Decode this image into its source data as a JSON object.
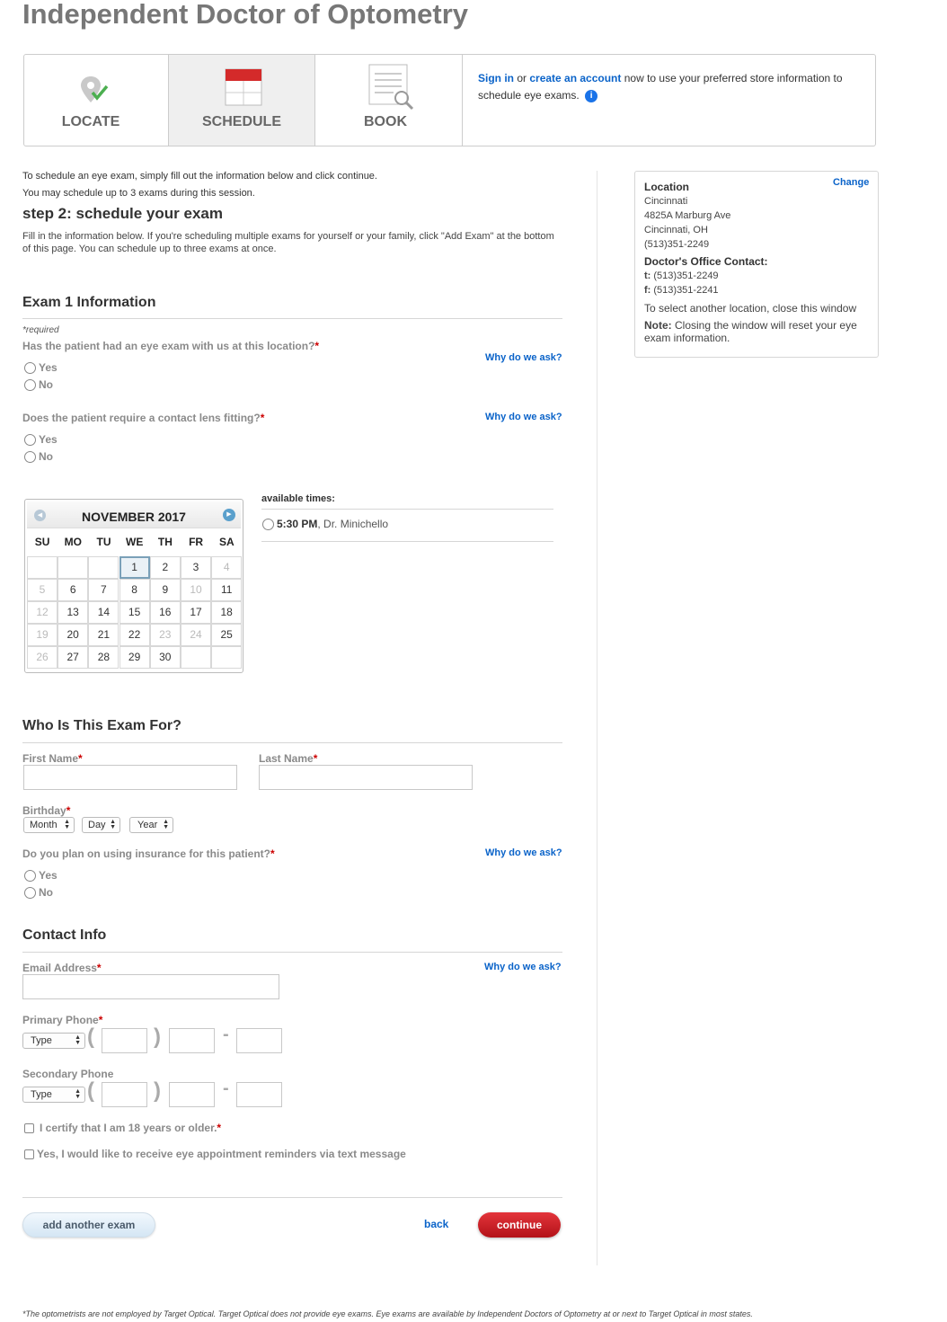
{
  "page_title": "Independent Doctor of Optometry",
  "steps": {
    "locate": "LOCATE",
    "schedule": "SCHEDULE",
    "book": "BOOK"
  },
  "signin_box": {
    "sign_in": "Sign in",
    "or": " or ",
    "create_account": "create an account",
    "rest": " now to use your preferred store information to schedule eye exams."
  },
  "intro": {
    "line1": "To schedule an eye exam, simply fill out the information below and click continue.",
    "line2": "You may schedule up to 3 exams during this session.",
    "step_heading": "step 2: schedule your exam",
    "instructions": "Fill in the information below. If you're scheduling multiple exams for yourself or your family, click \"Add Exam\" at the bottom of this page. You can schedule up to three exams at once."
  },
  "exam_info": {
    "title": "Exam 1 Information",
    "required_note": "*required",
    "q1": "Has the patient had an eye exam with us at this location?",
    "q2": "Does the patient require a contact lens fitting?",
    "why": "Why do we ask?",
    "yes": "Yes",
    "no": "No"
  },
  "calendar": {
    "month": "NOVEMBER 2017",
    "weekdays": [
      "SU",
      "MO",
      "TU",
      "WE",
      "TH",
      "FR",
      "SA"
    ],
    "weeks": [
      [
        "",
        "",
        "",
        "1",
        "2",
        "3",
        "4"
      ],
      [
        "5",
        "6",
        "7",
        "8",
        "9",
        "10",
        "11"
      ],
      [
        "12",
        "13",
        "14",
        "15",
        "16",
        "17",
        "18"
      ],
      [
        "19",
        "20",
        "21",
        "22",
        "23",
        "24",
        "25"
      ],
      [
        "26",
        "27",
        "28",
        "29",
        "30",
        "",
        ""
      ]
    ],
    "disabled": [
      "4",
      "5",
      "10",
      "12",
      "19",
      "23",
      "24",
      "26"
    ],
    "selected": "1"
  },
  "times": {
    "label": "available times:",
    "slot_time": "5:30 PM",
    "slot_doctor": ", Dr. Minichello"
  },
  "who": {
    "title": "Who Is This Exam For?",
    "first_name": "First Name",
    "last_name": "Last Name",
    "birthday": "Birthday",
    "month": "Month",
    "day": "Day",
    "year": "Year",
    "insurance_q": "Do you plan on using insurance for this patient?"
  },
  "contact": {
    "title": "Contact Info",
    "email": "Email Address",
    "primary_phone": "Primary Phone",
    "secondary_phone": "Secondary Phone",
    "type": "Type",
    "certify": "I certify that I am 18 years or older.",
    "reminders": "Yes, I would like to receive eye appointment reminders via text message"
  },
  "buttons": {
    "add_exam": "add another exam",
    "back": "back",
    "continue": "continue"
  },
  "location_panel": {
    "heading": "Location",
    "change": "Change",
    "city": "Cincinnati",
    "street": "4825A Marburg Ave",
    "city_state": "Cincinnati, OH",
    "phone": "(513)351-2249",
    "doctor_heading": "Doctor's Office Contact:",
    "t_label": "t:",
    "t_value": " (513)351-2249",
    "f_label": "f:",
    "f_value": " (513)351-2241",
    "select_note": "To select another location, close this window",
    "note_label": "Note:",
    "note_text": " Closing the window will reset your eye exam information."
  },
  "footer": "*The optometrists are not employed by Target Optical. Target Optical does not provide eye exams. Eye exams are available by Independent Doctors of Optometry at or next to Target Optical in most states.",
  "colors": {
    "link_blue": "#0a63c9",
    "required_red": "#cc0000",
    "continue_red": "#c8161d",
    "calendar_red": "#d42a2a"
  }
}
